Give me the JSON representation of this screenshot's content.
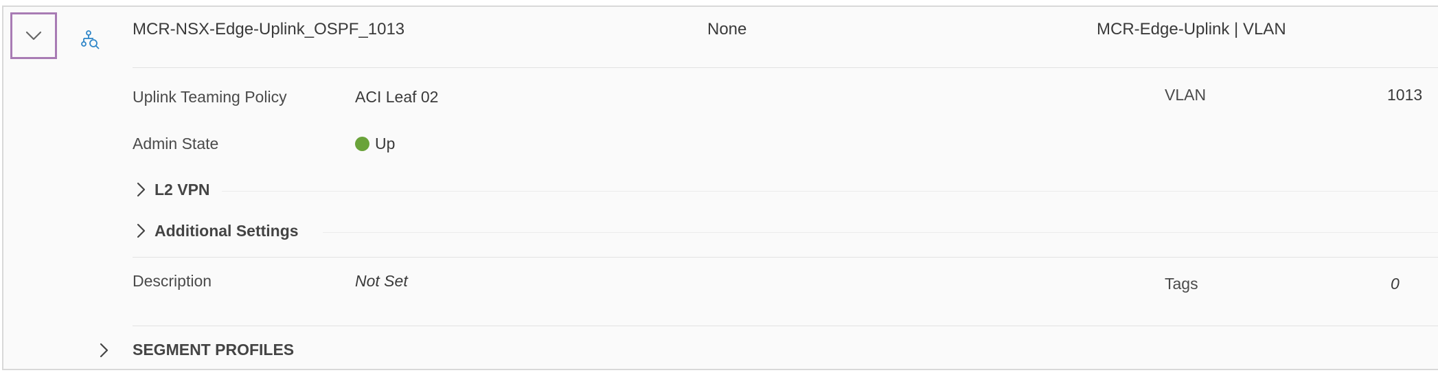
{
  "segment": {
    "name": "MCR-NSX-Edge-Uplink_OSPF_1013",
    "connectivity": "None",
    "transport_zone": "MCR-Edge-Uplink | VLAN"
  },
  "details": {
    "uplink_teaming_policy": {
      "label": "Uplink Teaming Policy",
      "value": "ACI Leaf 02"
    },
    "vlan": {
      "label": "VLAN",
      "value": "1013"
    },
    "admin_state": {
      "label": "Admin State",
      "value": "Up",
      "status_color": "#6aa33a"
    },
    "l2vpn": {
      "label": "L2 VPN"
    },
    "additional_settings": {
      "label": "Additional Settings"
    },
    "description": {
      "label": "Description",
      "value": "Not Set"
    },
    "tags": {
      "label": "Tags",
      "value": "0"
    }
  },
  "segment_profiles": {
    "label": "SEGMENT PROFILES"
  },
  "icons": {
    "row_toggle": "chevron-down-icon",
    "segment": "segment-network-icon",
    "expand": "chevron-right-icon"
  },
  "colors": {
    "focus_border": "#a87bb4",
    "icon_blue": "#2f86c8"
  }
}
